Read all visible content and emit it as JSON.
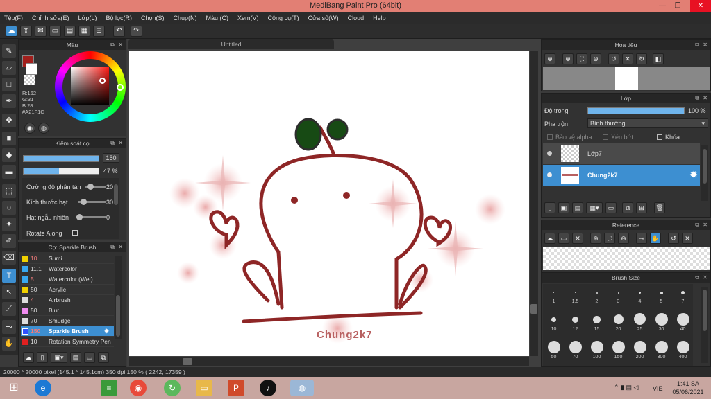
{
  "window": {
    "title": "MediBang Paint Pro (64bit)"
  },
  "menu": [
    "Tệp(F)",
    "Chỉnh sửa(E)",
    "Lớp(L)",
    "Bộ lọc(R)",
    "Chọn(S)",
    "Chụp(N)",
    "Màu (C)",
    "Xem(V)",
    "Công cụ(T)",
    "Cửa sổ(W)",
    "Cloud",
    "Help"
  ],
  "color_panel": {
    "title": "Màu",
    "r": "R:162",
    "g": "G:31",
    "b": "B:28",
    "hex": "#A21F1C",
    "accent": "#A21F1C"
  },
  "brush_control": {
    "title": "Kiểm soát cọ",
    "size": "150",
    "opacity": "47 %",
    "opacity_fraction": 0.47,
    "params": [
      {
        "label": "Cường độ phân tán",
        "value": "20"
      },
      {
        "label": "Kích thước hạt",
        "value": "30"
      },
      {
        "label": "Hạt ngẫu nhiên",
        "value": "0"
      },
      {
        "label": "Rotate Along",
        "value": ""
      }
    ]
  },
  "brush_list": {
    "title": "Cọ: Sparkle Brush",
    "items": [
      {
        "n": "10",
        "name": "Sumi",
        "color": "#f0d000"
      },
      {
        "n": "11.1",
        "name": "Watercolor",
        "color": "#38a8f0"
      },
      {
        "n": "5",
        "name": "Watercolor (Wet)",
        "color": "#38a8f0"
      },
      {
        "n": "50",
        "name": "Acrylic",
        "color": "#f0d000"
      },
      {
        "n": "4",
        "name": "Airbrush",
        "color": "#dddddd"
      },
      {
        "n": "50",
        "name": "Blur",
        "color": "#f08cf0"
      },
      {
        "n": "70",
        "name": "Smudge",
        "color": "#dddddd"
      },
      {
        "n": "150",
        "name": "Sparkle Brush",
        "color": "#3050ff",
        "selected": true
      },
      {
        "n": "10",
        "name": "Rotation Symmetry Pen",
        "color": "#e02020"
      }
    ]
  },
  "document": {
    "tab": "Untitled",
    "watermark": "Chung2k7"
  },
  "navigator": {
    "title": "Hoa tiêu"
  },
  "layers": {
    "title": "Lớp",
    "opacity_label": "Độ trong",
    "opacity": "100 %",
    "opacity_fraction": 1.0,
    "blend_label": "Pha trộn",
    "blend": "Bình thường",
    "alpha_label": "Bảo vệ alpha",
    "clip_label": "Xén bớt",
    "lock_label": "Khóa",
    "items": [
      {
        "name": "Lớp7"
      },
      {
        "name": "Chung2k7",
        "selected": true
      }
    ]
  },
  "reference": {
    "title": "Reference"
  },
  "brush_size": {
    "title": "Brush Size",
    "sizes": [
      "1",
      "1.5",
      "2",
      "3",
      "4",
      "5",
      "7",
      "10",
      "12",
      "15",
      "20",
      "25",
      "30",
      "40",
      "50",
      "70",
      "100",
      "150",
      "200",
      "300",
      "400"
    ]
  },
  "status": {
    "text": "20000 * 20000 pixel   (145.1 * 145.1cm)   350 dpi   150 %   ( 2242, 17359 )"
  },
  "taskbar": {
    "time": "1:41 SA",
    "date": "05/06/2021",
    "lang": "VIE"
  }
}
